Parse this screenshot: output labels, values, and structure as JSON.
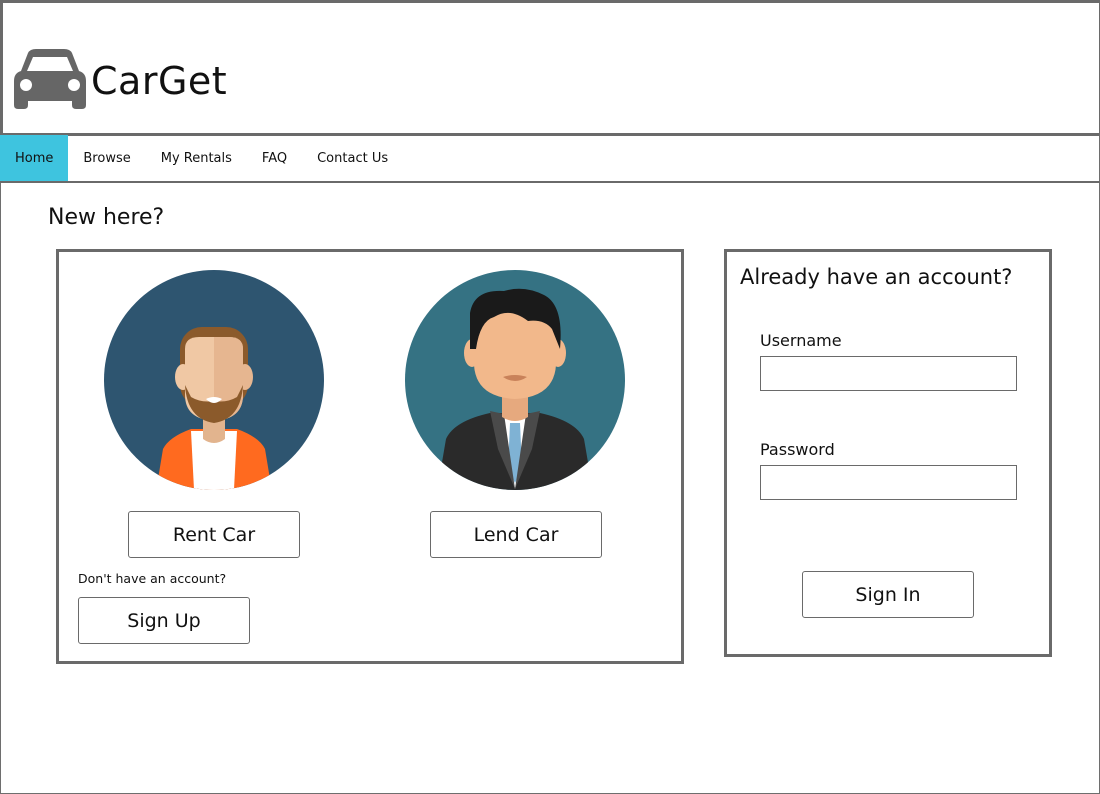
{
  "app": {
    "name": "CarGet",
    "logo_icon": "car-icon"
  },
  "nav": {
    "items": [
      {
        "label": "Home",
        "active": true
      },
      {
        "label": "Browse",
        "active": false
      },
      {
        "label": "My Rentals",
        "active": false
      },
      {
        "label": "FAQ",
        "active": false
      },
      {
        "label": "Contact Us",
        "active": false
      }
    ],
    "active_color": "#3ec4df"
  },
  "new_user": {
    "heading": "New here?",
    "renter_avatar": "bearded-man-avatar",
    "lender_avatar": "businessman-avatar",
    "rent_label": "Rent Car",
    "lend_label": "Lend Car",
    "no_account_text": "Don't have an account?",
    "signup_label": "Sign Up"
  },
  "login": {
    "heading": "Already have an account?",
    "username_label": "Username",
    "username_value": "",
    "password_label": "Password",
    "password_value": "",
    "signin_label": "Sign In"
  }
}
